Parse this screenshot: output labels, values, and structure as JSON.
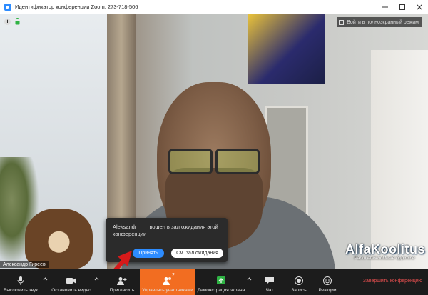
{
  "window": {
    "title": "Идентификатор конференции Zoom: 273-718-506",
    "controls": [
      "minimize",
      "maximize",
      "close"
    ]
  },
  "video": {
    "fullscreen_label": "Войти в полноэкранный режим",
    "participant_name": "Александр Гиреев",
    "watermark": {
      "title": "AlfaKoolitus",
      "subtitle": "Parim ettekoolituste õppimine"
    }
  },
  "popup": {
    "participant": "Aleksandr",
    "message": "вошел в зал ожидания этой конференции",
    "accept_label": "Принять",
    "waiting_room_label": "См. зал ожидания"
  },
  "toolbar": {
    "mute_label": "Выключить звук",
    "video_label": "Остановить видео",
    "invite_label": "Пригласить",
    "participants_label": "Управлять участниками",
    "participants_count": "2",
    "share_label": "Демонстрация экрана",
    "chat_label": "Чат",
    "record_label": "Запись",
    "reactions_label": "Реакции",
    "end_label": "Завершить конференцию"
  },
  "colors": {
    "accent_blue": "#2d8cff",
    "active_orange": "#f26d21",
    "share_green": "#2fb344",
    "end_red": "#e84f4f",
    "toolbar_bg": "#1c1c1c"
  }
}
